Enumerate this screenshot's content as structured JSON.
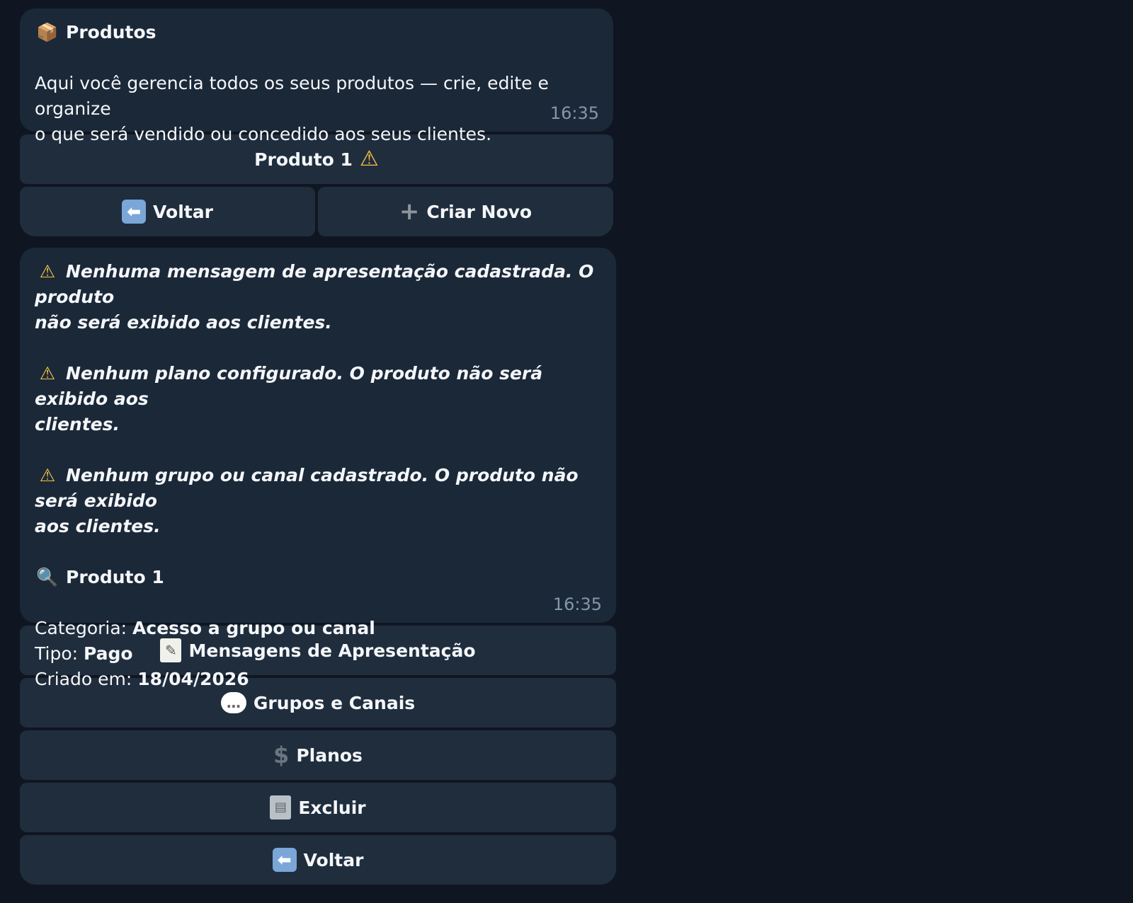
{
  "message1": {
    "title": "Produtos",
    "title_icon": "package-icon",
    "body": "Aqui você gerencia todos os seus produtos — crie, edite e organize o que será vendido ou concedido aos seus clientes.",
    "body_line1": "Aqui você gerencia todos os seus produtos — crie, edite e organize",
    "body_line2": "o que será vendido ou concedido aos seus clientes.",
    "time": "16:35"
  },
  "keyboard1": {
    "product_button": "Produto 1",
    "back_button": "Voltar",
    "create_button": "Criar Novo"
  },
  "message2": {
    "warnings": [
      {
        "line1": "Nenhuma mensagem de apresentação cadastrada. O produto",
        "line2": "não será exibido aos clientes."
      },
      {
        "line1": "Nenhum plano configurado. O produto não será exibido aos",
        "line2": "clientes."
      },
      {
        "line1": "Nenhum grupo ou canal cadastrado. O produto não será exibido",
        "line2": "aos clientes."
      }
    ],
    "product_name": "Produto 1",
    "category_label": "Categoria:",
    "category_value": "Acesso a grupo ou canal",
    "type_label": "Tipo:",
    "type_value": "Pago",
    "created_label": "Criado em:",
    "created_value": "18/04/2026",
    "time": "16:35"
  },
  "keyboard2": {
    "messages_button": "Mensagens de Apresentação",
    "groups_button": "Grupos e Canais",
    "plans_button": "Planos",
    "delete_button": "Excluir",
    "back_button": "Voltar"
  },
  "colors": {
    "background": "#0f1621",
    "bubble": "#1b2838",
    "button": "#1f2d3d",
    "timestamp": "#8496a9",
    "warning": "#f6c343"
  }
}
